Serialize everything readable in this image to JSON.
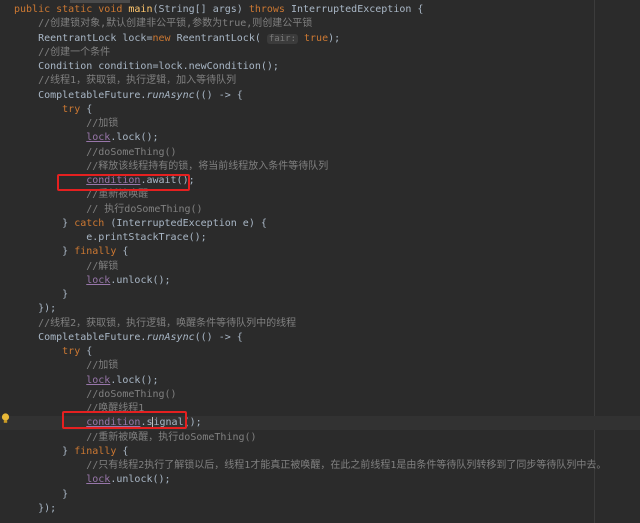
{
  "lines": [
    {
      "parts": [
        [
          "kw",
          "public static void "
        ],
        [
          "fn",
          "main"
        ],
        [
          "",
          "(String[] args) "
        ],
        [
          "kw",
          "throws "
        ],
        [
          "",
          "InterruptedException {"
        ]
      ]
    },
    {
      "parts": [
        [
          "cm",
          "    //创建锁对象,默认创建非公平锁,参数为true,则创建公平锁"
        ]
      ]
    },
    {
      "parts": [
        [
          "",
          "    ReentrantLock lock="
        ],
        [
          "kw",
          "new "
        ],
        [
          "",
          "ReentrantLock( "
        ],
        [
          "hint",
          "fair:"
        ],
        [
          "kw",
          " true"
        ],
        [
          "",
          ");"
        ]
      ]
    },
    {
      "parts": [
        [
          "cm",
          "    //创建一个条件"
        ]
      ]
    },
    {
      "parts": [
        [
          "",
          "    Condition condition=lock.newCondition();"
        ]
      ]
    },
    {
      "parts": [
        [
          "cm",
          "    //线程1，获取锁，执行逻辑，加入等待队列"
        ]
      ]
    },
    {
      "parts": [
        [
          "",
          "    CompletableFuture."
        ],
        [
          "it",
          "runAsync"
        ],
        [
          "",
          "(() -> {"
        ]
      ]
    },
    {
      "parts": [
        [
          "kw",
          "        try "
        ],
        [
          "",
          "{"
        ]
      ]
    },
    {
      "parts": [
        [
          "cm",
          "            //加锁"
        ]
      ]
    },
    {
      "parts": [
        [
          "",
          "            "
        ],
        [
          "fld",
          "lock"
        ],
        [
          "",
          ".lock();"
        ]
      ]
    },
    {
      "parts": [
        [
          "cm",
          "            //doSomeThing()"
        ]
      ]
    },
    {
      "parts": [
        [
          "cm",
          "            //释放该线程持有的锁，将当前线程放入条件等待队列"
        ]
      ]
    },
    {
      "parts": [
        [
          "",
          "            "
        ],
        [
          "fld",
          "condition"
        ],
        [
          "",
          ".await();"
        ]
      ]
    },
    {
      "parts": [
        [
          "cm",
          "            //重新被唤醒"
        ]
      ]
    },
    {
      "parts": [
        [
          "cm",
          "            // 执行doSomeThing()"
        ]
      ]
    },
    {
      "parts": [
        [
          "",
          "        } "
        ],
        [
          "kw",
          "catch "
        ],
        [
          "",
          "(InterruptedException e) {"
        ]
      ]
    },
    {
      "parts": [
        [
          "",
          "            e.printStackTrace();"
        ]
      ]
    },
    {
      "parts": [
        [
          "",
          "        } "
        ],
        [
          "kw",
          "finally "
        ],
        [
          "",
          "{"
        ]
      ]
    },
    {
      "parts": [
        [
          "cm",
          "            //解锁"
        ]
      ]
    },
    {
      "parts": [
        [
          "",
          "            "
        ],
        [
          "fld",
          "lock"
        ],
        [
          "",
          ".unlock();"
        ]
      ]
    },
    {
      "parts": [
        [
          "",
          "        }"
        ]
      ]
    },
    {
      "parts": [
        [
          "",
          "    });"
        ]
      ]
    },
    {
      "parts": [
        [
          "cm",
          "    //线程2，获取锁，执行逻辑，唤醒条件等待队列中的线程"
        ]
      ]
    },
    {
      "parts": [
        [
          "",
          "    CompletableFuture."
        ],
        [
          "it",
          "runAsync"
        ],
        [
          "",
          "(() -> {"
        ]
      ]
    },
    {
      "parts": [
        [
          "kw",
          "        try "
        ],
        [
          "",
          "{"
        ]
      ]
    },
    {
      "parts": [
        [
          "cm",
          "            //加锁"
        ]
      ]
    },
    {
      "parts": [
        [
          "",
          "            "
        ],
        [
          "fld",
          "lock"
        ],
        [
          "",
          ".lock();"
        ]
      ]
    },
    {
      "parts": [
        [
          "cm",
          "            //doSomeThing()"
        ]
      ]
    },
    {
      "parts": [
        [
          "cm",
          "            //唤醒线程1"
        ]
      ]
    },
    {
      "parts": [
        [
          "",
          "            "
        ],
        [
          "fld",
          "condition"
        ],
        [
          "",
          ".s"
        ],
        [
          "caret",
          ""
        ],
        [
          "",
          "ignal();"
        ]
      ]
    },
    {
      "parts": [
        [
          "cm",
          "            //重新被唤醒，执行doSomeThing()"
        ]
      ]
    },
    {
      "parts": [
        [
          "",
          "        } "
        ],
        [
          "kw",
          "finally "
        ],
        [
          "",
          "{"
        ]
      ]
    },
    {
      "parts": [
        [
          "cm",
          "            //只有线程2执行了解锁以后，线程1才能真正被唤醒，在此之前线程1是由条件等待队列转移到了同步等待队列中去。"
        ]
      ]
    },
    {
      "parts": [
        [
          "",
          "            "
        ],
        [
          "fld",
          "lock"
        ],
        [
          "",
          ".unlock();"
        ]
      ]
    },
    {
      "parts": [
        [
          "",
          "        }"
        ]
      ]
    },
    {
      "parts": [
        [
          "",
          "    });"
        ]
      ]
    }
  ],
  "colors": {
    "background": "#2b2b2b",
    "keyword": "#cc7832",
    "comment": "#808080",
    "method": "#ffc66d",
    "field": "#9876aa",
    "highlight_box": "#e52020"
  },
  "icons": {
    "gutter": "lightbulb-icon"
  }
}
